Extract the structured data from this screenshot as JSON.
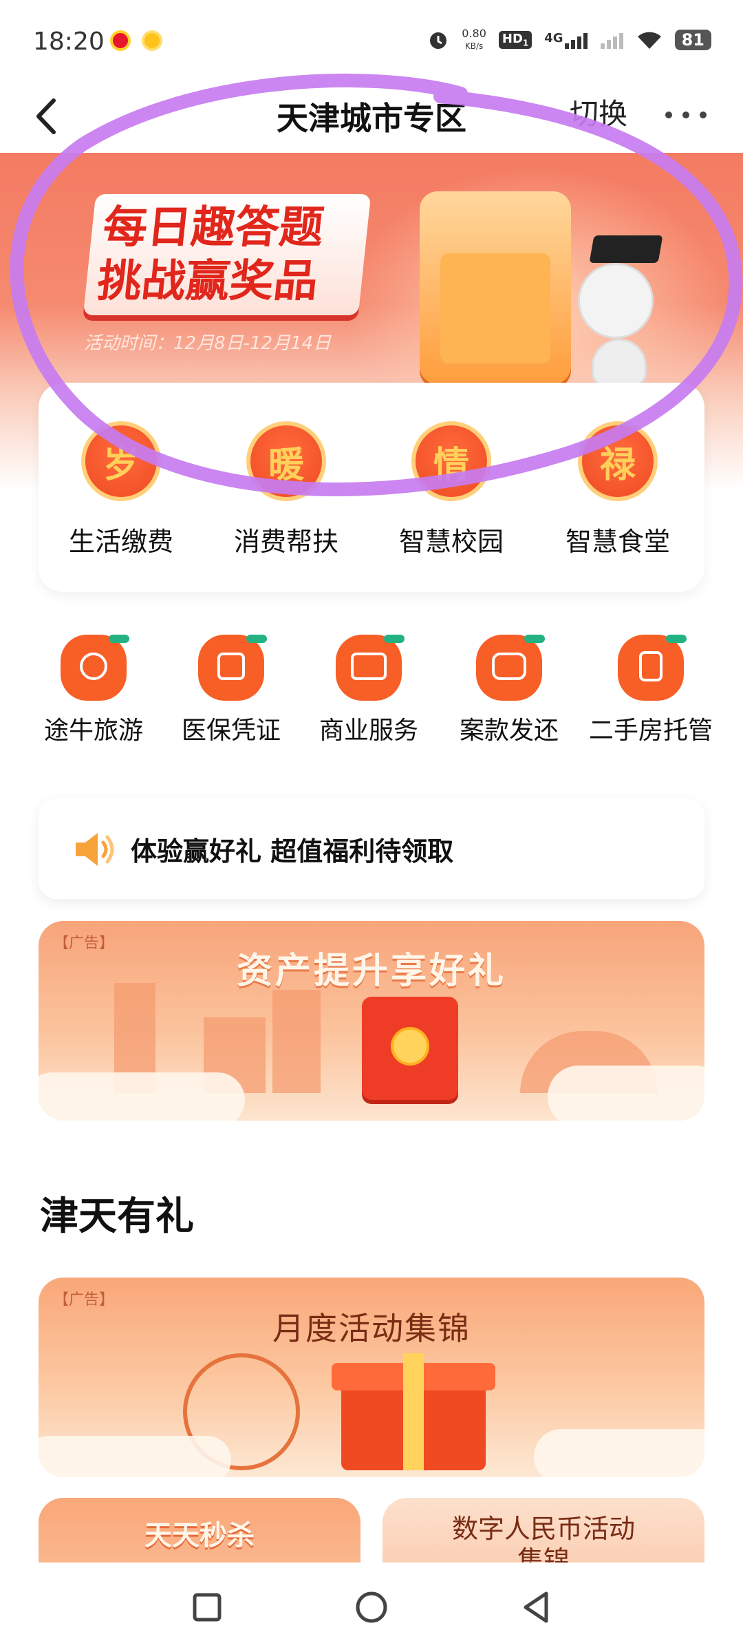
{
  "status_bar": {
    "time": "18:20",
    "net_speed_value": "0.80",
    "net_speed_unit": "KB/s",
    "hd_label": "HD",
    "hd_sub": "1",
    "network": "4G",
    "battery": "81",
    "icons": [
      "weibo-icon",
      "app-coin-icon",
      "alarm-icon",
      "signal-icon",
      "wifi-icon",
      "battery-icon"
    ]
  },
  "header": {
    "title": "天津城市专区",
    "switch_label": "切换",
    "back_icon": "chevron-left-icon",
    "more_icon": "more-icon"
  },
  "banner": {
    "line1": "每日趣答题",
    "line2": "挑战赢奖品",
    "date": "活动时间：12月8日-12月14日"
  },
  "services": [
    {
      "label": "生活缴费",
      "char": "岁"
    },
    {
      "label": "消费帮扶",
      "char": "暖"
    },
    {
      "label": "智慧校园",
      "char": "情"
    },
    {
      "label": "智慧食堂",
      "char": "禄"
    }
  ],
  "grid": [
    {
      "label": "途牛旅游",
      "icon": "ox-icon"
    },
    {
      "label": "医保凭证",
      "icon": "id-card-icon"
    },
    {
      "label": "商业服务",
      "icon": "yen-card-icon"
    },
    {
      "label": "案款发还",
      "icon": "wallet-icon"
    },
    {
      "label": "二手房托管",
      "icon": "document-icon"
    }
  ],
  "notice": {
    "text": "体验赢好礼 超值福利待领取",
    "icon": "speaker-icon"
  },
  "ads": {
    "asset": {
      "tag": "【广告】",
      "title": "资产提升享好礼"
    },
    "section_title": "津天有礼",
    "monthly": {
      "tag": "【广告】",
      "title": "月度活动集锦"
    },
    "small_left": {
      "title": "天天秒杀"
    },
    "small_right": {
      "title": "数字人民币活动集锦"
    }
  },
  "colors": {
    "accent": "#f85f26",
    "banner_red": "#e1261c",
    "annotation": "#c77cf0",
    "leaf": "#24b283"
  },
  "nav": {
    "icons": [
      "recent-apps-icon",
      "home-icon",
      "back-icon"
    ]
  }
}
